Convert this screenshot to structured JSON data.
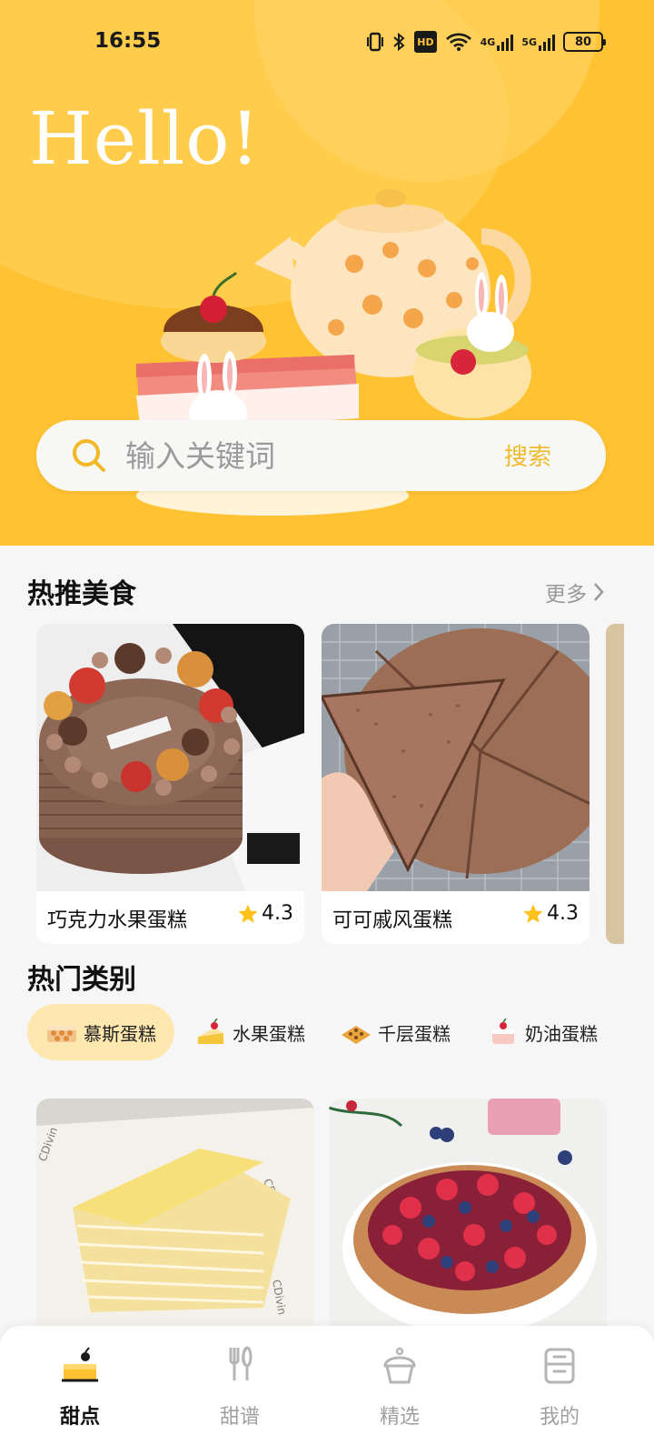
{
  "status_bar": {
    "time": "16:55",
    "hd_label": "HD",
    "network_4g": "4G",
    "network_5g": "5G",
    "battery": "80"
  },
  "hero": {
    "greeting": "Hello!"
  },
  "search": {
    "placeholder": "输入关键词",
    "button_label": "搜索"
  },
  "hot_section": {
    "title": "热推美食",
    "more_label": "更多",
    "items": [
      {
        "name": "巧克力水果蛋糕",
        "rating": "4.3",
        "image": "chocolate-fruit-cake-photo"
      },
      {
        "name": "可可戚风蛋糕",
        "rating": "4.3",
        "image": "cocoa-chiffon-cake-photo"
      }
    ]
  },
  "category_section": {
    "title": "热门类别",
    "items": [
      {
        "label": "慕斯蛋糕",
        "active": true,
        "icon": "mousse-cake-icon"
      },
      {
        "label": "水果蛋糕",
        "active": false,
        "icon": "fruit-cake-icon"
      },
      {
        "label": "千层蛋糕",
        "active": false,
        "icon": "layer-cake-icon"
      },
      {
        "label": "奶油蛋糕",
        "active": false,
        "icon": "cream-cake-icon"
      }
    ]
  },
  "feed": [
    {
      "image": "durian-crepe-cake-photo"
    },
    {
      "image": "berry-tart-photo"
    }
  ],
  "tabbar": {
    "items": [
      {
        "label": "甜点",
        "active": true,
        "icon": "cake-icon"
      },
      {
        "label": "甜谱",
        "active": false,
        "icon": "utensils-icon"
      },
      {
        "label": "精选",
        "active": false,
        "icon": "cupcake-icon"
      },
      {
        "label": "我的",
        "active": false,
        "icon": "profile-icon"
      }
    ]
  },
  "colors": {
    "brand_yellow": "#ffc232",
    "accent_text": "#f0bb2c",
    "active_chip": "#ffe8b0",
    "star": "#ffc21a"
  }
}
